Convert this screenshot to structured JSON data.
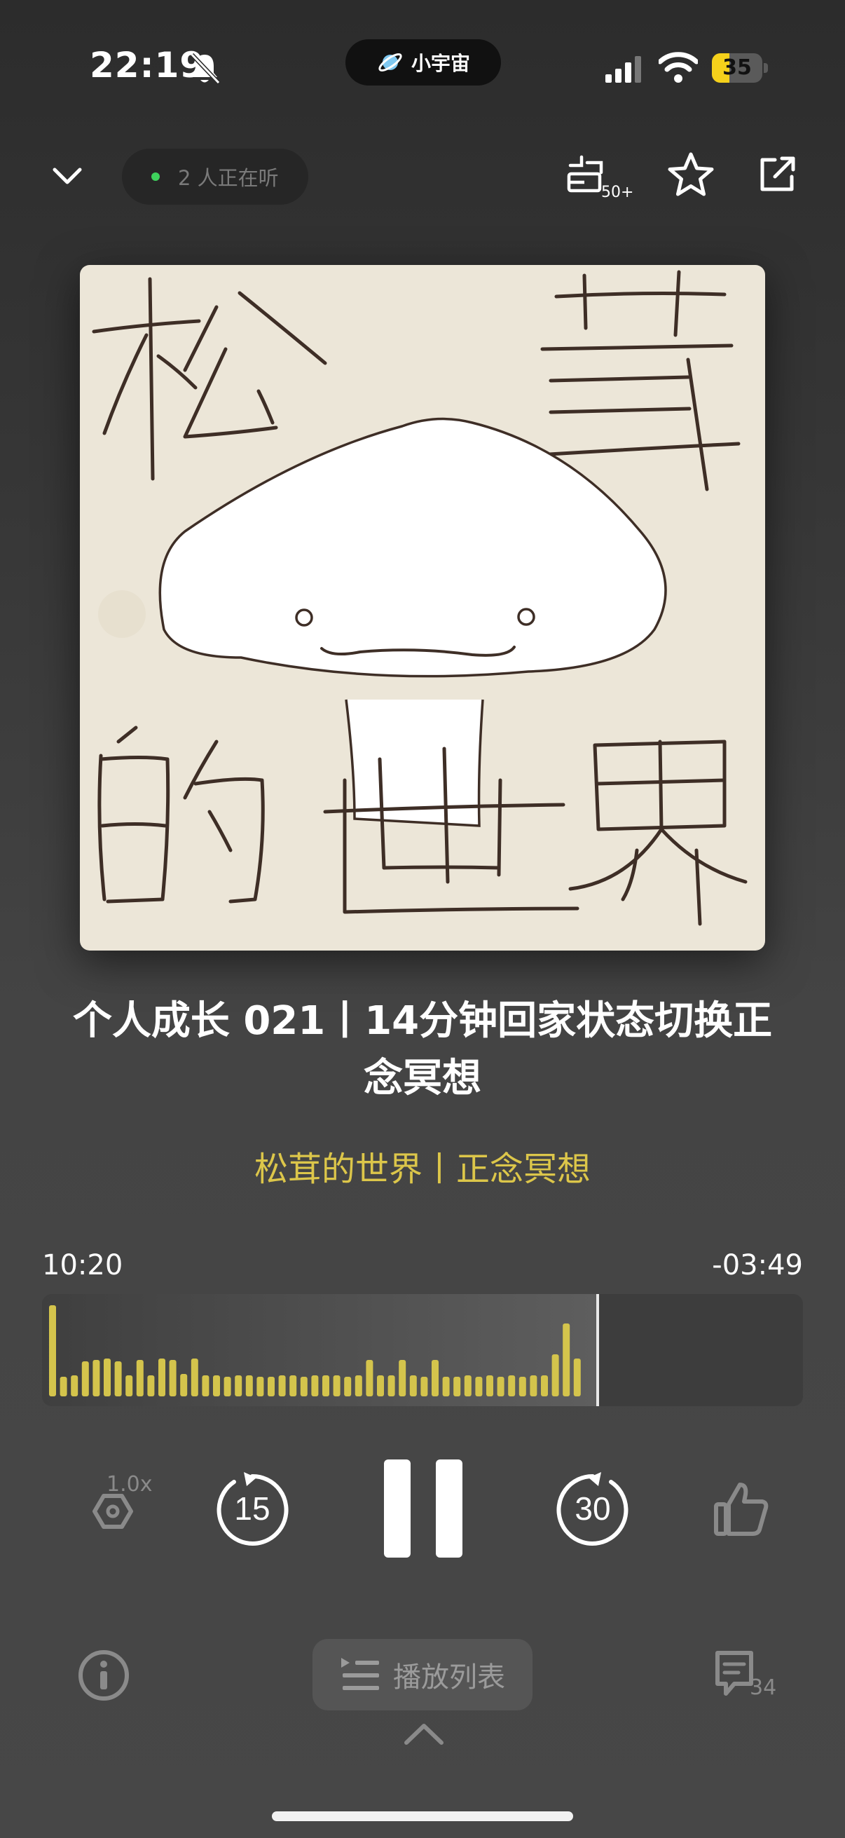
{
  "status_bar": {
    "time": "22:19",
    "island_label": "小宇宙",
    "battery_level": "35",
    "battery_fraction": 0.35
  },
  "header": {
    "listening_text": "2 人正在听",
    "subscribe_count": "50+"
  },
  "cover": {
    "artwork_text": "松茸的世界"
  },
  "episode": {
    "title": "个人成长 021丨14分钟回家状态切换正念冥想",
    "podcast": "松茸的世界丨正念冥想"
  },
  "progress": {
    "elapsed": "10:20",
    "remaining": "-03:49",
    "played_fraction": 0.73
  },
  "controls": {
    "speed": "1.0x",
    "rewind_seconds": "15",
    "forward_seconds": "30"
  },
  "bottom": {
    "playlist_label": "播放列表",
    "comment_count": "34"
  },
  "colors": {
    "accent_yellow": "#dcc64a",
    "waveform_played": "#d4c44c",
    "waveform_unplayed": "#4e4e4e",
    "listening_dot": "#3ed15c",
    "battery": "#f5d11b"
  },
  "icons": [
    "bell-slash-icon",
    "planet-icon",
    "signal-icon",
    "wifi-icon",
    "chevron-down-icon",
    "subscribe-icon",
    "star-icon",
    "share-icon",
    "speed-icon",
    "rewind-icon",
    "pause-icon",
    "forward-icon",
    "thumbs-up-icon",
    "info-icon",
    "playlist-icon",
    "chevron-up-icon",
    "comment-icon"
  ]
}
